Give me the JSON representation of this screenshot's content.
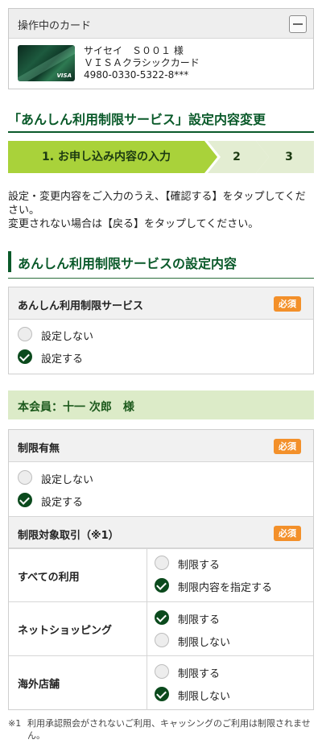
{
  "card_panel": {
    "title": "操作中のカード",
    "collapse_icon": "minus-icon",
    "card_name_line": "サイセイ　Ｓ００１ 様",
    "card_type_line": "ＶＩＳＡクラシックカード",
    "card_number_line": "4980-0330-5322-8***",
    "card_brand": "VISA"
  },
  "page_title": "「あんしん利用制限サービス」設定内容変更",
  "steps": [
    {
      "label": "1. お申し込み内容の入力",
      "active": true
    },
    {
      "label": "2",
      "active": false
    },
    {
      "label": "3",
      "active": false
    }
  ],
  "instructions": {
    "line1": "設定・変更内容をご入力のうえ、【確認する】をタップしてください。",
    "line2": "変更されない場合は【戻る】をタップしてください。"
  },
  "section_title": "あんしん利用制限サービスの設定内容",
  "service_block": {
    "label": "あんしん利用制限サービス",
    "badge": "必須",
    "options": [
      {
        "label": "設定しない",
        "selected": false
      },
      {
        "label": "設定する",
        "selected": true
      }
    ]
  },
  "member_label": "本会員：十一 次郎　様",
  "restriction_block": {
    "label": "制限有無",
    "badge": "必須",
    "options": [
      {
        "label": "設定しない",
        "selected": false
      },
      {
        "label": "設定する",
        "selected": true
      }
    ],
    "target_label": "制限対象取引（※1）",
    "target_badge": "必須",
    "rows": [
      {
        "category": "すべての利用",
        "options": [
          {
            "label": "制限する",
            "selected": false
          },
          {
            "label": "制限内容を指定する",
            "selected": true
          }
        ]
      },
      {
        "category": "ネットショッピング",
        "options": [
          {
            "label": "制限する",
            "selected": true
          },
          {
            "label": "制限しない",
            "selected": false
          }
        ]
      },
      {
        "category": "海外店舗",
        "options": [
          {
            "label": "制限する",
            "selected": false
          },
          {
            "label": "制限しない",
            "selected": true
          }
        ]
      }
    ]
  },
  "footnote": {
    "mark": "※1",
    "text": "利用承認照会がされないご利用、キャッシングのご利用は制限されません。"
  }
}
